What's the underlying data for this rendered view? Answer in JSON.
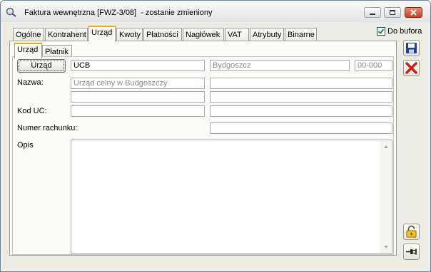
{
  "window": {
    "title": "Faktura wewnętrzna [FWZ-3/08]  - zostanie zmieniony",
    "minimize_icon": "minimize-icon",
    "maximize_icon": "maximize-icon",
    "close_icon": "close-icon"
  },
  "tabs": [
    {
      "label": "Ogólne"
    },
    {
      "label": "Kontrahent"
    },
    {
      "label": "Urząd"
    },
    {
      "label": "Kwoty"
    },
    {
      "label": "Płatności"
    },
    {
      "label": "Nagłówek"
    },
    {
      "label": "VAT"
    },
    {
      "label": "Atrybuty"
    },
    {
      "label": "Binarne"
    }
  ],
  "active_tab": "Urząd",
  "subtabs": [
    {
      "label": "Urząd"
    },
    {
      "label": "Płatnik"
    }
  ],
  "do_bufora": {
    "label": "Do bufora",
    "checked": true
  },
  "form": {
    "urzad_button": "Urząd",
    "code": "UCB",
    "city": "Bydgoszcz",
    "postal_code": "00-000",
    "nazwa_label": "Nazwa:",
    "name_line1": "Urząd celny w Budgoszczy",
    "name_line2": "",
    "name_right1": "",
    "name_right2": "",
    "kod_uc_label": "Kod UC:",
    "kod_uc_value": "",
    "kod_uc_right": "",
    "numer_label": "Numer rachunku:",
    "numer_value": "",
    "opis_label": "Opis",
    "opis_value": ""
  },
  "side_buttons": {
    "save_icon": "save-icon",
    "cancel_icon": "cancel-icon",
    "lock_icon": "padlock-icon",
    "pin_icon": "pin-icon"
  },
  "colors": {
    "active_tab_accent": "#f5a621",
    "window_background": "#ecece4",
    "close_button": "#c44425"
  }
}
